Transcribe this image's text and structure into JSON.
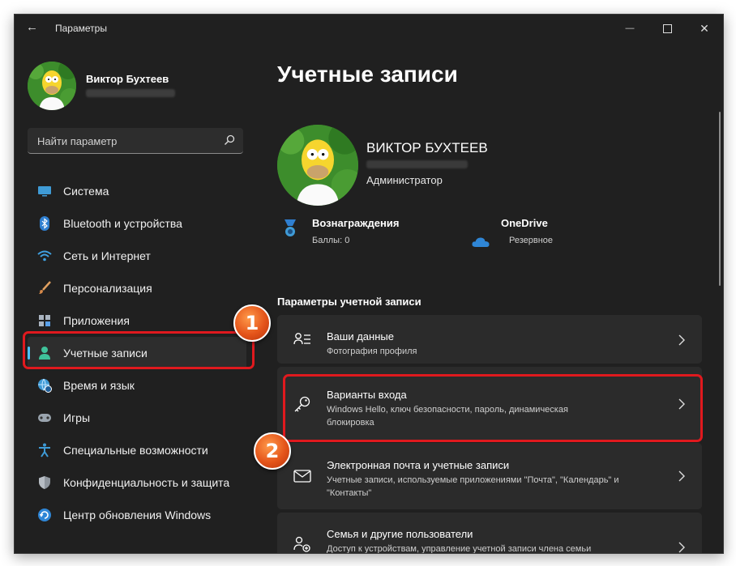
{
  "window": {
    "title": "Параметры",
    "back_glyph": "←",
    "min_glyph": "—",
    "close_glyph": "✕"
  },
  "profile": {
    "name": "Виктор Бухтеев"
  },
  "search": {
    "placeholder": "Найти параметр"
  },
  "nav": [
    {
      "label": "Система",
      "icon": "monitor-icon"
    },
    {
      "label": "Bluetooth и устройства",
      "icon": "bluetooth-icon"
    },
    {
      "label": "Сеть и Интернет",
      "icon": "wifi-icon"
    },
    {
      "label": "Персонализация",
      "icon": "brush-icon"
    },
    {
      "label": "Приложения",
      "icon": "apps-icon"
    },
    {
      "label": "Учетные записи",
      "icon": "person-icon",
      "active": true
    },
    {
      "label": "Время и язык",
      "icon": "globe-clock-icon"
    },
    {
      "label": "Игры",
      "icon": "gamepad-icon"
    },
    {
      "label": "Специальные возможности",
      "icon": "accessibility-icon"
    },
    {
      "label": "Конфиденциальность и защита",
      "icon": "shield-icon"
    },
    {
      "label": "Центр обновления Windows",
      "icon": "update-icon"
    }
  ],
  "main": {
    "title": "Учетные записи",
    "user": {
      "name": "ВИКТОР БУХТЕЕВ",
      "role": "Администратор"
    },
    "rewards": {
      "title": "Вознаграждения",
      "sub": "Баллы: 0"
    },
    "onedrive": {
      "title": "OneDrive",
      "sub": "Резервное"
    },
    "section": "Параметры учетной записи",
    "cards": [
      {
        "title": "Ваши данные",
        "sub": "Фотография профиля",
        "icon": "person-list-icon"
      },
      {
        "title": "Варианты входа",
        "sub": "Windows Hello, ключ безопасности, пароль, динамическая блокировка",
        "icon": "key-icon"
      },
      {
        "title": "Электронная почта и учетные записи",
        "sub": "Учетные записи, используемые приложениями \"Почта\", \"Календарь\" и \"Контакты\"",
        "icon": "mail-icon"
      },
      {
        "title": "Семья и другие пользователи",
        "sub": "Доступ к устройствам, управление учетной записи члена семьи",
        "icon": "family-icon"
      }
    ]
  },
  "annotations": {
    "step1": "1",
    "step2": "2"
  },
  "colors": {
    "accent": "#4cc2ff",
    "highlight": "#e0191e",
    "badge": "#e4541a",
    "bg": "#202020",
    "card": "#2b2b2b"
  }
}
